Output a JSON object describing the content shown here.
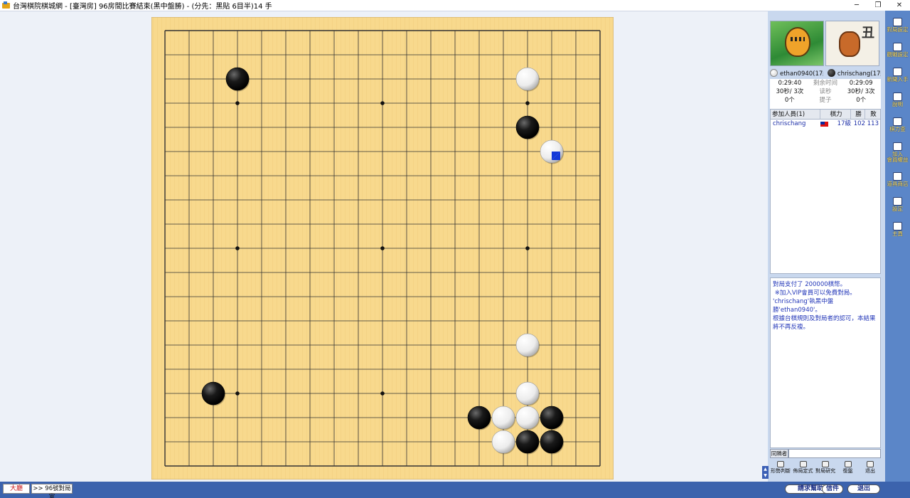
{
  "window": {
    "title": "台灣棋院棋城網 - [臺灣房]  96房間比賽結束(黑中盤勝) - (分先：黑貼 6目半)14 手",
    "minimize": "─",
    "restore": "❐",
    "close": "✕"
  },
  "board": {
    "size": 19,
    "background": "#f8d98d",
    "line_color": "#333333",
    "stones": [
      {
        "col": 3,
        "row": 2,
        "color": "black"
      },
      {
        "col": 15,
        "row": 2,
        "color": "white"
      },
      {
        "col": 15,
        "row": 4,
        "color": "black"
      },
      {
        "col": 16,
        "row": 5,
        "color": "white",
        "last": true
      },
      {
        "col": 15,
        "row": 13,
        "color": "white"
      },
      {
        "col": 2,
        "row": 15,
        "color": "black"
      },
      {
        "col": 15,
        "row": 15,
        "color": "white"
      },
      {
        "col": 13,
        "row": 16,
        "color": "black"
      },
      {
        "col": 14,
        "row": 16,
        "color": "white"
      },
      {
        "col": 15,
        "row": 16,
        "color": "white"
      },
      {
        "col": 16,
        "row": 16,
        "color": "black"
      },
      {
        "col": 14,
        "row": 17,
        "color": "white"
      },
      {
        "col": 15,
        "row": 17,
        "color": "black"
      },
      {
        "col": 16,
        "row": 17,
        "color": "black"
      }
    ]
  },
  "players": {
    "white_name": "ethan0940(17級",
    "black_name": "chrischang(17級"
  },
  "clock": {
    "white_time": "0:29:40",
    "time_label": "剩余时间",
    "black_time": "0:29:09",
    "white_byoyomi": "30秒/ 3次",
    "byoyomi_label": "读秒",
    "black_byoyomi": "30秒/ 3次",
    "white_captures": "0个",
    "captures_label": "提子",
    "black_captures": "0个"
  },
  "roster": {
    "headers": [
      "参加人員(1)",
      "棋力",
      "勝",
      "敗"
    ],
    "rows": [
      {
        "name": "chrischang",
        "rank": "17級",
        "wins": "102",
        "losses": "113"
      }
    ]
  },
  "chat": {
    "lines": [
      "對局支付了 200000棋幣。",
      " ※加入VIP會員可以免費對局。",
      "'chrischang'執黑中盤勝'ethan0940'。",
      "根據台棋規則及對局者的認可，本結果將不再反複。"
    ],
    "target_label": "同隣者",
    "input_value": ""
  },
  "toolbar": {
    "items": [
      "形勢判斷",
      "佈局定式",
      "對局研究",
      "復盤",
      "退出"
    ]
  },
  "sidebar": {
    "items": [
      "對局設定",
      "觀戰設定",
      "新聞入手",
      "說明",
      "棋力查",
      "加入\n會員權益",
      "道具商店",
      "設定",
      "主頁"
    ]
  },
  "bottom": {
    "lobby_tab": "大廳",
    "room_tab": ">> 96號對局室",
    "help_button": "請求幫助",
    "mail_button": "信件",
    "exit_button": "退出"
  },
  "colors": {
    "panel_bg": "#c9d8ee",
    "sidebar_bg": "#5b86c8",
    "bottom_bg": "#3c63ad",
    "chat_text": "#2236b8"
  }
}
